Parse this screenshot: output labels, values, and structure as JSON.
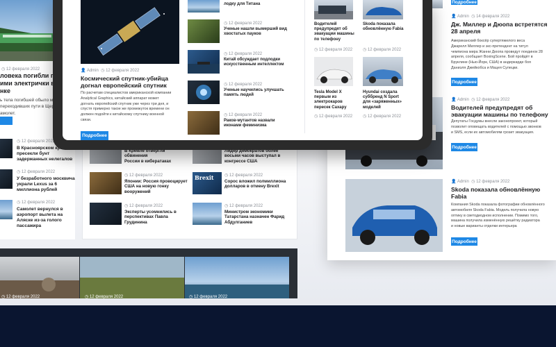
{
  "left_panel": {
    "partial_title": "ловека погибли под\nими электрички в\nнке",
    "partial_text": "ь тела погибшей обыло мужчине и\nпереходивших пути в Щербин\nамолет.",
    "date": "12 февраля 2022",
    "list": [
      {
        "date": "12 февраля 2022",
        "title": "В Красноярском крае\nпресекли бунт\nзадержанных нелегалов"
      },
      {
        "date": "12 февраля 2022",
        "title": "У безработного москвича\nукрали Lexus за 6\nмиллиона рублей"
      },
      {
        "date": "12 февраля 2022",
        "title": "Самолет вернулся в\nаэропорт вылета на\nАляске из-за голого\nпассажира"
      }
    ]
  },
  "tablet": {
    "featured": {
      "author": "Admin",
      "date": "12 февраля 2022",
      "title": "Космический спутник-убийца\nдогнал европейский спутник",
      "text": "По расчетам специалистов американской компании\nAnalytical Graphics, китайский аппарат может\nдогнать европейский спутник уже через три дня, и\nспустя примерно такое же промежуток времени он\nдолжен подойти к китайскому спутнику военной\nсвязи.",
      "button": "Подробнее"
    },
    "list": [
      {
        "date": "",
        "title": "лодку для Титана"
      },
      {
        "date": "12 февраля 2022",
        "title": "Ученые нашли вымерший вид\nхвостатых пауков"
      },
      {
        "date": "12 февраля 2022",
        "title": "Китай обсуждает подлодки\nискусственным интеллектом"
      },
      {
        "date": "12 февраля 2022",
        "title": "Ученые научились улучшать\nпамять людей"
      },
      {
        "date": "12 февраля 2022",
        "title": "Раков-мутантов назвали\nиконами феминизма"
      }
    ],
    "grid": [
      {
        "date": "12 февраля 2022",
        "title": "Водителей\nпредупредят об\nэвакуации машины\nпо телефону"
      },
      {
        "date": "12 февраля 2022",
        "title": "Skoda показала\nобновлённую Fabia"
      },
      {
        "date": "12 февраля 2022",
        "title": "Tesla Model X\nпервым из\nэлектрокаров\nпересек Сахару"
      },
      {
        "date": "12 февраля 2022",
        "title": "Hyundai создала\nсуббренд N Sport\nдля «заряженных»\nмоделей"
      }
    ]
  },
  "middle_list": [
    {
      "date": "",
      "title": "В Кремле отвергли обвинения\nРоссии в кибератаках"
    },
    {
      "date": "12 февраля 2022",
      "title": "Японии: Россия провоцирует\nСША на новую гонку\nвооружений"
    },
    {
      "date": "12 февраля 2022",
      "title": "Эксперты усомнились в\nперспективах Павла\nГрудинина"
    }
  ],
  "middle_list2": [
    {
      "date": "",
      "title": "Лидер демократов более\nвосьми часов выступал в\nконгрессе США"
    },
    {
      "date": "12 февраля 2022",
      "title": "Сорос вложил полмиллиона\nдолларов в отмену Brexit"
    },
    {
      "date": "12 февраля 2022",
      "title": "Министром экономики\nТатарстана назначен Фарид\nАбдулганиев"
    }
  ],
  "band_dates": [
    "12 февраля 2022",
    "12 февраля 2022",
    "12 февраля 2022"
  ],
  "right_panel": {
    "top_button": "Подробнее",
    "top_meta_author": "Admin",
    "top_meta_date": "14 февраля 2022",
    "a1": {
      "title": "Дж. Миллер и Дюопа встретятся\n28 апреля",
      "text": "Американский боксёр супертяжелого веса\nДжарелл Миллер и экс-претендент на титул\nчемпиона мира Жанни Дюопа проведут поединок 28\nапреля, сообщает BoxingScene. Бой пройдёт в\nБруклине (Нью-Йорк, США) в андеркарде боя\nДаниэля Джейкобса и Мацея Сулецки.",
      "button": "Подробнее"
    },
    "a2": {
      "author": "Admin",
      "date": "12 февраля 2022",
      "title": "Водителей предупредят об\nэвакуации машины по телефону",
      "text": "Депутаты Госдумы внесли законопроект, который\nпозволит оповещать водителей с помощью звонков\nи SMS, если их автомобилям грозит эвакуация.",
      "button": "Подробнее"
    },
    "a3": {
      "author": "Admin",
      "date": "12 февраля 2022",
      "title": "Skoda показала обновлённую\nFabia",
      "text": "Компания Skoda показала фотографии обновлённого\nавтомобиля Skoda Fabia. Модель получила новую\nоптику в светодиодном исполнении. Помимо того,\nмашина получила изменённую решётку радиатора\nи новые варианты отделки интерьера",
      "button": "Подробнее"
    }
  }
}
